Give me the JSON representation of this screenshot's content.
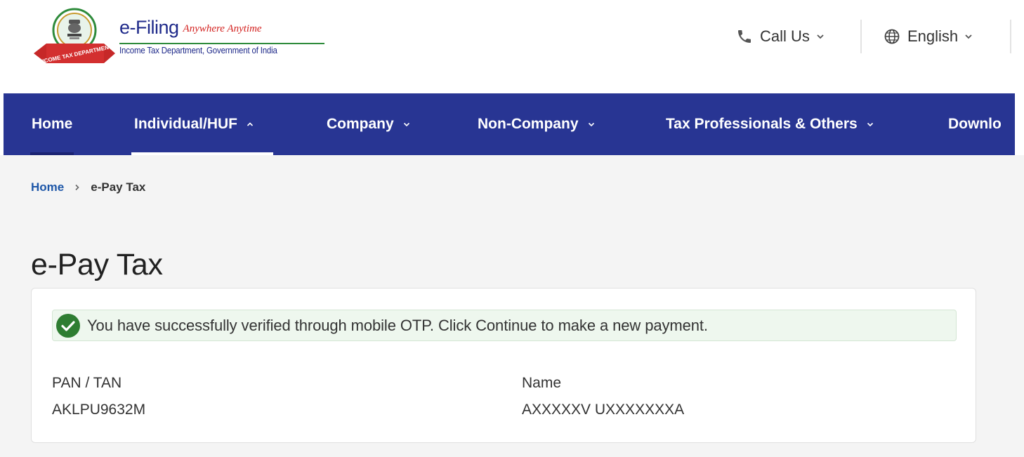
{
  "header": {
    "brand_title": "e-Filing",
    "brand_tagline": "Anywhere Anytime",
    "brand_subtitle": "Income Tax Department, Government of India",
    "emblem_ribbon_text": "INCOME TAX DEPARTMENT",
    "call_us_label": "Call Us",
    "language_label": "English"
  },
  "nav": {
    "items": [
      {
        "label": "Home"
      },
      {
        "label": "Individual/HUF"
      },
      {
        "label": "Company"
      },
      {
        "label": "Non-Company"
      },
      {
        "label": "Tax Professionals & Others"
      },
      {
        "label": "Downlo"
      }
    ],
    "active_item": "Individual/HUF"
  },
  "breadcrumb": {
    "home": "Home",
    "current": "e-Pay Tax"
  },
  "page": {
    "title": "e-Pay Tax"
  },
  "alert": {
    "type": "success",
    "message": "You have successfully verified through mobile OTP. Click Continue to make a new payment."
  },
  "details": {
    "pan_label": "PAN / TAN",
    "pan_value": "AKLPU9632M",
    "name_label": "Name",
    "name_value": "AXXXXXV UXXXXXXXA"
  },
  "colors": {
    "nav_background": "#283593",
    "brand_blue": "#1f2a8a",
    "tagline_red": "#d3211f",
    "success_green": "#2e7d32",
    "link_blue": "#1e57a8"
  },
  "icons": {
    "call": "phone-icon",
    "language": "globe-icon",
    "chevron": "chevron-down-icon",
    "alert": "check-circle-icon"
  }
}
